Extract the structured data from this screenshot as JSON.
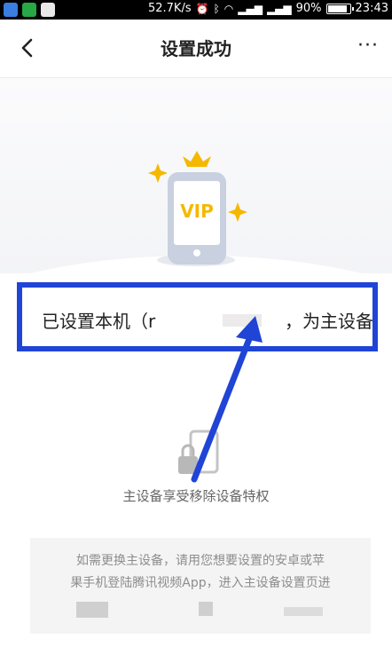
{
  "status_bar": {
    "network_speed": "52.7K/s",
    "battery": "90%",
    "battery_level": 0.9,
    "time": "23:43"
  },
  "nav": {
    "title": "设置成功",
    "more_label": "···"
  },
  "hero": {
    "badge_text": "VIP"
  },
  "device": {
    "prefix_text": "已设置本机（r",
    "suffix_text": "，为主设备"
  },
  "privilege_text": "主设备享受移除设备特权",
  "note": {
    "line1": "如需更换主设备，请用您想要设置的安卓或苹",
    "line2": "果手机登陆腾讯视频App，进入主设备设置页进"
  },
  "colors": {
    "highlight": "#1f44d6",
    "gold": "#f5b800",
    "phone": "#c9d0e0"
  }
}
